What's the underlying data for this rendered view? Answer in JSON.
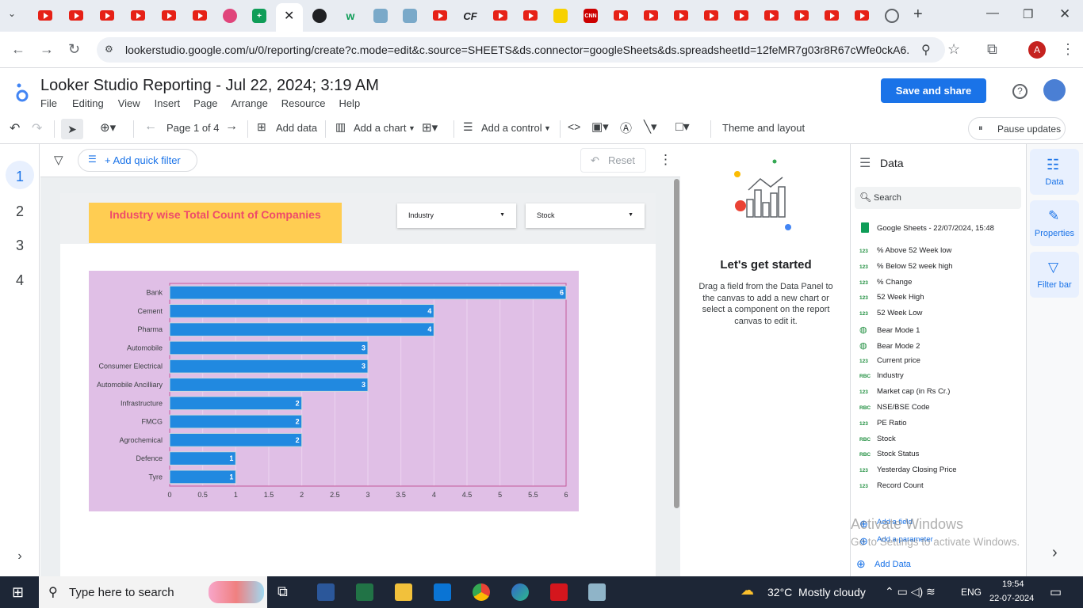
{
  "browser": {
    "url": "lookerstudio.google.com/u/0/reporting/create?c.mode=edit&c.source=SHEETS&ds.connector=googleSheets&ds.spreadsheetId=12feMR7g03r8R67cWfe0ckA6...",
    "profile_initial": "A"
  },
  "app": {
    "title": "Looker Studio Reporting - Jul 22, 2024; 3:19 AM",
    "menu": [
      "File",
      "Editing",
      "View",
      "Insert",
      "Page",
      "Arrange",
      "Resource",
      "Help"
    ],
    "save_label": "Save and share"
  },
  "toolbar": {
    "page_indicator": "Page 1 of 4",
    "add_data": "Add data",
    "add_chart": "Add a chart",
    "add_control": "Add a control",
    "theme": "Theme and layout",
    "pause": "Pause updates"
  },
  "pages": [
    "1",
    "2",
    "3",
    "4"
  ],
  "filterbar": {
    "add_filter": "+ Add quick filter",
    "reset": "Reset"
  },
  "report": {
    "title": "Industry wise Total Count of Companies",
    "controls": [
      "Industry",
      "Stock"
    ]
  },
  "chart_data": {
    "type": "bar",
    "orientation": "horizontal",
    "categories": [
      "Bank",
      "Cement",
      "Pharma",
      "Automobile",
      "Consumer Electrical",
      "Automobile Ancilliary",
      "Infrastructure",
      "FMCG",
      "Agrochemical",
      "Defence",
      "Tyre"
    ],
    "values": [
      6,
      4,
      4,
      3,
      3,
      3,
      2,
      2,
      2,
      1,
      1
    ],
    "xticks": [
      "0",
      "0.5",
      "1",
      "1.5",
      "2",
      "2.5",
      "3",
      "3.5",
      "4",
      "4.5",
      "5",
      "5.5",
      "6"
    ],
    "xlim": [
      0,
      6
    ],
    "bar_color": "#2189e0",
    "background": "#e0bfe6"
  },
  "get_started": {
    "heading": "Let's get started",
    "body": "Drag a field from the Data Panel to the canvas to add a new chart or select a component on the report canvas to edit it."
  },
  "data_panel": {
    "title": "Data",
    "search_placeholder": "Search",
    "source": "Google Sheets - 22/07/2024, 15:48",
    "fields": [
      {
        "type": "123",
        "name": "% Above 52 Week low"
      },
      {
        "type": "123",
        "name": "% Below 52 week high"
      },
      {
        "type": "123",
        "name": "% Change"
      },
      {
        "type": "123",
        "name": "52 Week High"
      },
      {
        "type": "123",
        "name": "52 Week Low"
      },
      {
        "type": "geo",
        "name": "Bear Mode 1"
      },
      {
        "type": "geo",
        "name": "Bear Mode 2"
      },
      {
        "type": "123",
        "name": "Current price"
      },
      {
        "type": "RBC",
        "name": "Industry"
      },
      {
        "type": "123",
        "name": "Market cap (in Rs Cr.)"
      },
      {
        "type": "RBC",
        "name": "NSE/BSE Code"
      },
      {
        "type": "123",
        "name": "PE Ratio"
      },
      {
        "type": "RBC",
        "name": "Stock"
      },
      {
        "type": "RBC",
        "name": "Stock Status"
      },
      {
        "type": "123",
        "name": "Yesterday Closing Price"
      },
      {
        "type": "123",
        "name": "Record Count"
      }
    ],
    "add_field": "Add a field",
    "add_parameter": "Add a parameter",
    "add_data": "Add Data"
  },
  "rail": [
    "Data",
    "Properties",
    "Filter bar"
  ],
  "watermark": {
    "line1": "Activate Windows",
    "line2": "Go to Settings to activate Windows."
  },
  "taskbar": {
    "search": "Type here to search",
    "weather": "32°C  Mostly cloudy",
    "lang": "ENG",
    "time": "19:54",
    "date": "22-07-2024"
  }
}
